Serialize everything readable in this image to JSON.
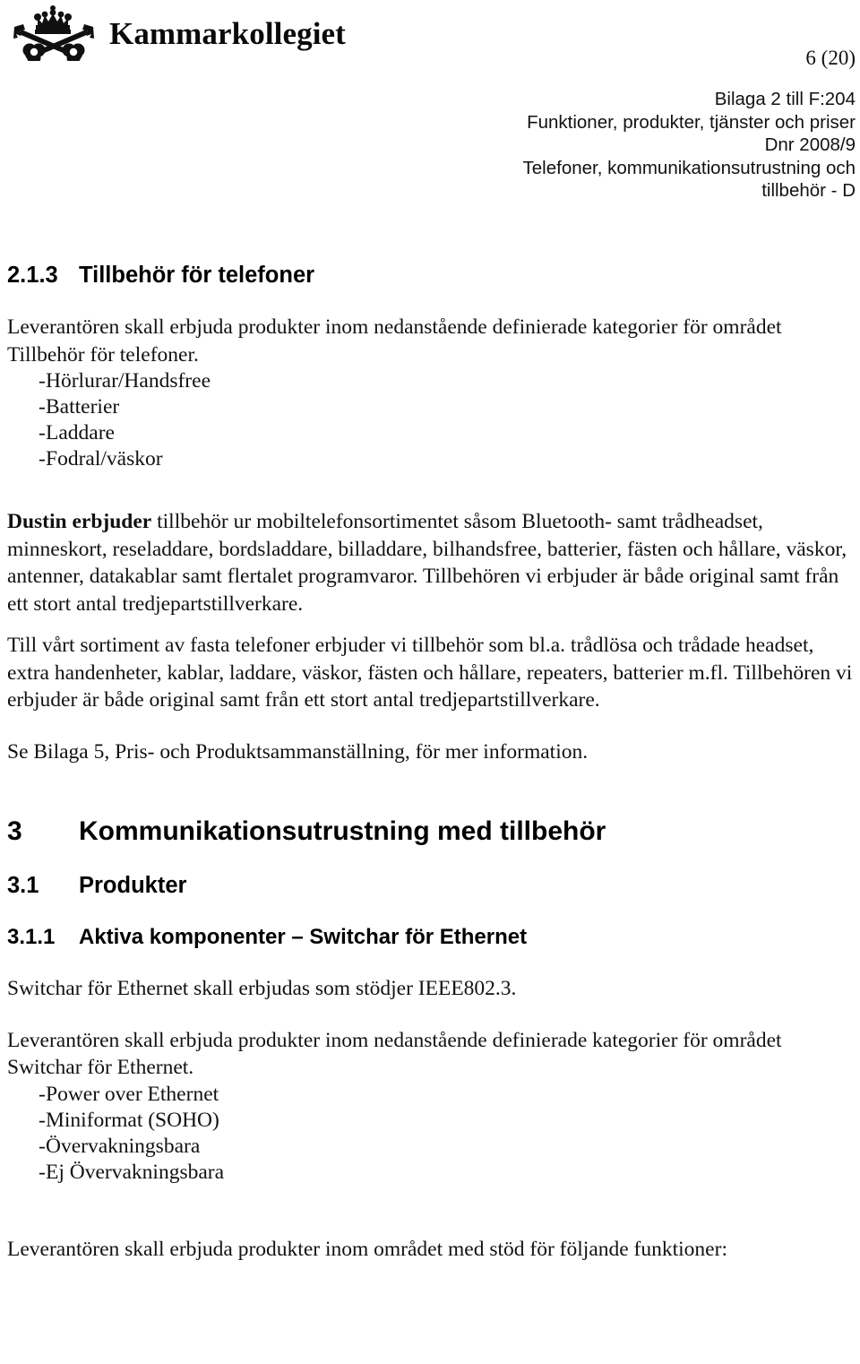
{
  "header": {
    "logo_alt": "Kammarkollegiet crown and crossed keys crest",
    "wordmark": "Kammarkollegiet",
    "page_number": "6 (20)",
    "doc_ref_lines": [
      "Bilaga 2 till F:204",
      "Funktioner, produkter, tjänster och priser",
      "Dnr 2008/9",
      "Telefoner, kommunikationsutrustning och",
      "tillbehör - D"
    ]
  },
  "sections": {
    "s213": {
      "number": "2.1.3",
      "title": "Tillbehör för telefoner",
      "intro": "Leverantören skall erbjuda produkter inom nedanstående definierade kategorier för området Tillbehör för telefoner.",
      "list": [
        "Hörlurar/Handsfree",
        "Batterier",
        "Laddare",
        "Fodral/väskor"
      ],
      "para_dustin_bold": "Dustin erbjuder",
      "para_dustin_rest": " tillbehör ur mobiltelefonsortimentet såsom Bluetooth- samt trådheadset, minneskort, reseladdare, bordsladdare, billaddare, bilhandsfree, batterier, fästen och hållare, väskor, antenner, datakablar samt flertalet programvaror. Tillbehören vi erbjuder är både original samt från ett stort antal tredjepartstillverkare.",
      "para_fasta": "Till vårt sortiment av fasta telefoner erbjuder vi tillbehör som bl.a. trådlösa och trådade headset, extra handenheter, kablar, laddare, väskor, fästen och hållare, repeaters, batterier m.fl.  Tillbehören vi erbjuder är både original samt från ett stort antal tredjepartstillverkare.",
      "para_bilaga": "Se Bilaga 5, Pris- och Produktsammanställning, för mer information."
    },
    "s3": {
      "number": "3",
      "title": "Kommunikationsutrustning med tillbehör"
    },
    "s31": {
      "number": "3.1",
      "title": "Produkter"
    },
    "s311": {
      "number": "3.1.1",
      "title": "Aktiva komponenter – Switchar för Ethernet",
      "para_ieee": "Switchar för Ethernet skall erbjudas som stödjer IEEE802.3.",
      "intro": "Leverantören skall erbjuda produkter inom nedanstående definierade kategorier för området Switchar för Ethernet.",
      "list": [
        "Power over Ethernet",
        "Miniformat (SOHO)",
        "Övervakningsbara",
        "Ej Övervakningsbara"
      ],
      "para_funktioner": "Leverantören skall erbjuda produkter inom området med stöd för följande funktioner:"
    }
  },
  "list_marker": "-"
}
